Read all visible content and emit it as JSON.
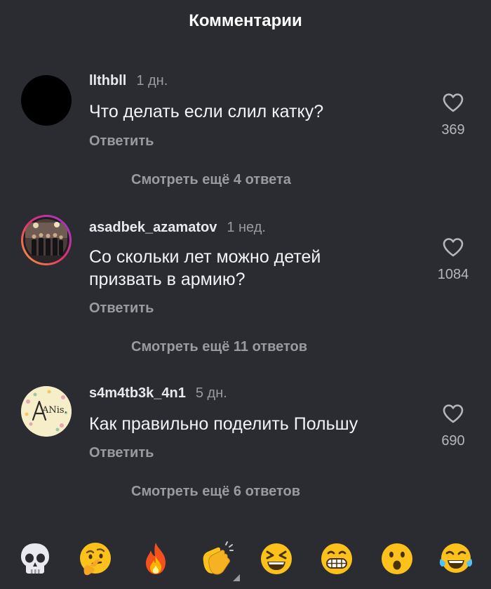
{
  "header": {
    "title": "Комментарии"
  },
  "comments": [
    {
      "username": "llthbll",
      "time": "1 дн.",
      "text": "Что делать если слил катку?",
      "reply_label": "Ответить",
      "likes": "369",
      "more_replies": "Смотреть ещё 4 ответа"
    },
    {
      "username": "asadbek_azamatov",
      "time": "1 нед.",
      "text": "Со скольки лет можно детей призвать в армию?",
      "reply_label": "Ответить",
      "likes": "1084",
      "more_replies": "Смотреть ещё 11 ответов"
    },
    {
      "username": "s4m4tb3k_4n1",
      "time": "5 дн.",
      "text": "Как правильно поделить Польшу",
      "reply_label": "Ответить",
      "likes": "690",
      "more_replies": "Смотреть ещё 6 ответов"
    }
  ],
  "avatar_text": {
    "c3": "ANis."
  },
  "emoji_bar": [
    "skull-emoji",
    "thinking-face-emoji",
    "fire-emoji",
    "clapping-hands-emoji",
    "laughing-squint-emoji",
    "grinning-teeth-emoji",
    "astonished-face-emoji",
    "tears-of-joy-emoji"
  ],
  "colors": {
    "background": "#2b2c31",
    "secondary_text": "#9a9ba1",
    "story_ring": "#e1306c"
  }
}
